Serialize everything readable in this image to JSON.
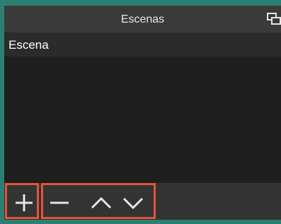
{
  "panel": {
    "title": "Escenas",
    "undock_icon": "undock-icon"
  },
  "scenes": {
    "items": [
      {
        "label": "Escena"
      }
    ]
  },
  "toolbar": {
    "buttons": [
      {
        "name": "add-scene-button",
        "icon": "plus-icon"
      },
      {
        "name": "remove-scene-button",
        "icon": "minus-icon"
      },
      {
        "name": "move-scene-up-button",
        "icon": "chevron-up-icon"
      },
      {
        "name": "move-scene-down-button",
        "icon": "chevron-down-icon"
      }
    ]
  },
  "colors": {
    "highlight": "#e2553a",
    "desktop": "#2e7f73",
    "list_background": "#1f1f1f",
    "header_background": "#3a3a3a"
  }
}
